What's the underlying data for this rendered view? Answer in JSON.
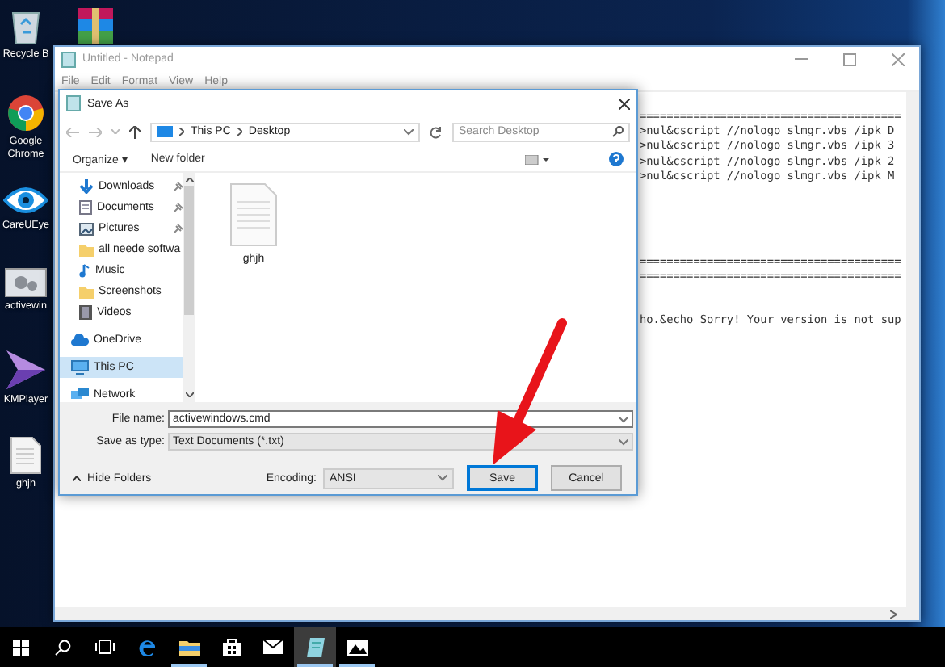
{
  "desktop_icons": [
    {
      "label": "Recycle B",
      "kind": "recycle-bin"
    },
    {
      "label": "Google Chrome",
      "kind": "chrome"
    },
    {
      "label": "CareUEye",
      "kind": "eye"
    },
    {
      "label": "activewin",
      "kind": "script"
    },
    {
      "label": "KMPlayer",
      "kind": "player"
    },
    {
      "label": "ghjh",
      "kind": "text-file"
    }
  ],
  "notepad": {
    "title": "Untitled - Notepad",
    "menu": [
      "File",
      "Edit",
      "Format",
      "View",
      "Help"
    ],
    "text_blocks": [
      [
        "=======================================",
        ">nul&cscript //nologo slmgr.vbs /ipk D",
        ">nul&cscript //nologo slmgr.vbs /ipk 3",
        ">nul&cscript //nologo slmgr.vbs /ipk 2",
        ">nul&cscript //nologo slmgr.vbs /ipk M"
      ],
      [
        "=======================================",
        "======================================="
      ],
      [
        "ho.&echo Sorry! Your version is not sup"
      ]
    ]
  },
  "save_dialog": {
    "title": "Save As",
    "address": [
      "This PC",
      "Desktop"
    ],
    "search": {
      "placeholder": "Search Desktop"
    },
    "toolbar": {
      "organize": "Organize ▾",
      "new_folder": "New folder"
    },
    "quick_access": [
      {
        "label": "Downloads",
        "kind": "download",
        "pinned": true
      },
      {
        "label": "Documents",
        "kind": "document",
        "pinned": true
      },
      {
        "label": "Pictures",
        "kind": "picture",
        "pinned": true
      },
      {
        "label": "all neede softwa",
        "kind": "folder",
        "pinned": false
      },
      {
        "label": "Music",
        "kind": "music",
        "pinned": false
      },
      {
        "label": "Screenshots",
        "kind": "folder",
        "pinned": false
      },
      {
        "label": "Videos",
        "kind": "video",
        "pinned": false
      }
    ],
    "locations": [
      {
        "label": "OneDrive",
        "kind": "cloud",
        "selected": false
      },
      {
        "label": "This PC",
        "kind": "computer",
        "selected": true
      },
      {
        "label": "Network",
        "kind": "network",
        "selected": false
      }
    ],
    "files": [
      {
        "name": "ghjh"
      }
    ],
    "file_name": {
      "label": "File name:",
      "value": "activewindows.cmd"
    },
    "save_type": {
      "label": "Save as type:",
      "value": "Text Documents (*.txt)"
    },
    "hide_folders": "Hide Folders",
    "encoding": {
      "label": "Encoding:",
      "value": "ANSI"
    },
    "buttons": [
      {
        "label": "Save",
        "focused": true
      },
      {
        "label": "Cancel",
        "focused": false
      }
    ]
  },
  "taskbar": [
    {
      "kind": "start",
      "running": false,
      "selected": false
    },
    {
      "kind": "search",
      "running": false,
      "selected": false
    },
    {
      "kind": "task-view",
      "running": false,
      "selected": false
    },
    {
      "kind": "edge",
      "running": false,
      "selected": false
    },
    {
      "kind": "explorer",
      "running": true,
      "selected": false
    },
    {
      "kind": "store",
      "running": false,
      "selected": false
    },
    {
      "kind": "mail",
      "running": false,
      "selected": false
    },
    {
      "kind": "notepad",
      "running": true,
      "selected": true
    },
    {
      "kind": "photos",
      "running": true,
      "selected": false
    }
  ]
}
